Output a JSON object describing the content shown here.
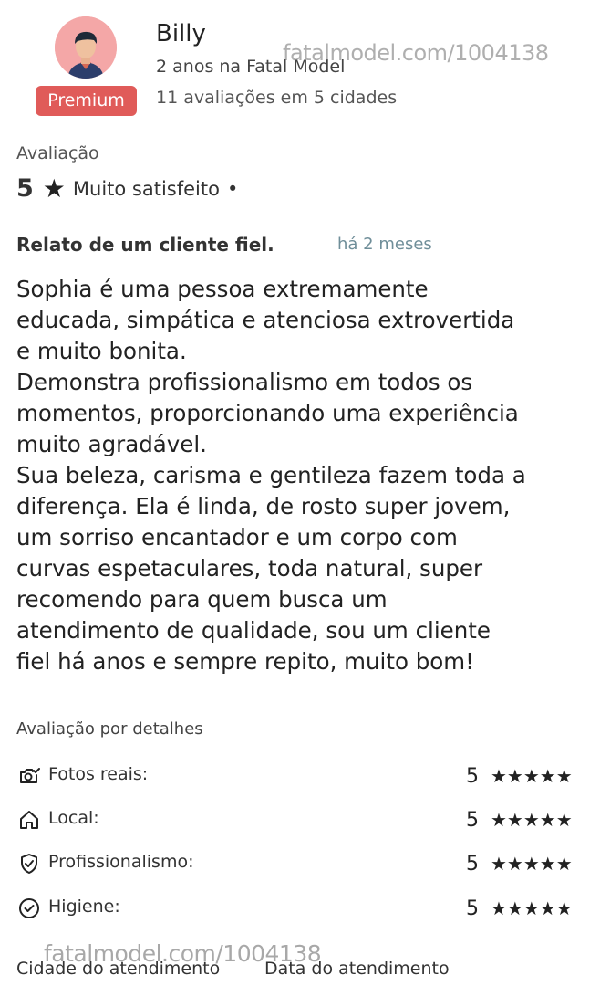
{
  "reviewer": {
    "name": "Billy",
    "since": "2 anos na Fatal Model",
    "reviews_count": "11 avaliações em 5 cidades",
    "badge": "Premium",
    "avatar_icon": "person-avatar-icon"
  },
  "watermark": "fatalmodel.com/1004138",
  "rating": {
    "label": "Avaliação",
    "value": "5",
    "star": "★",
    "text": "Muito satisfeito",
    "dot": "•"
  },
  "review": {
    "title": "Relato de um cliente fiel.",
    "time": "há 2 meses",
    "body": "Sophia é uma pessoa extremamente\neducada, simpática e atenciosa extrovertida\ne muito bonita.\nDemonstra profissionalismo em todos os\nmomentos, proporcionando uma experiência\nmuito agradável.\nSua beleza, carisma e gentileza fazem toda a\ndiferença. Ela é linda, de rosto super jovem,\num sorriso encantador e um corpo com\ncurvas espetaculares, toda natural, super\nrecomendo para quem busca um\natendimento de qualidade, sou um cliente\nfiel há anos e sempre repito, muito bom!"
  },
  "details": {
    "label": "Avaliação por detalhes",
    "items": [
      {
        "name": "Fotos reais:",
        "score": "5",
        "stars": "★★★★★",
        "icon": "camera-check-icon"
      },
      {
        "name": "Local:",
        "score": "5",
        "stars": "★★★★★",
        "icon": "house-icon"
      },
      {
        "name": "Profissionalismo:",
        "score": "5",
        "stars": "★★★★★",
        "icon": "shield-check-icon"
      },
      {
        "name": "Higiene:",
        "score": "5",
        "stars": "★★★★★",
        "icon": "circle-check-icon"
      }
    ]
  },
  "footer": {
    "left": "Cidade do atendimento",
    "right": "Data do atendimento"
  },
  "colors": {
    "badge": "#e05b59",
    "avatar_bg": "#f4a7a7",
    "time": "#6f8e99"
  }
}
